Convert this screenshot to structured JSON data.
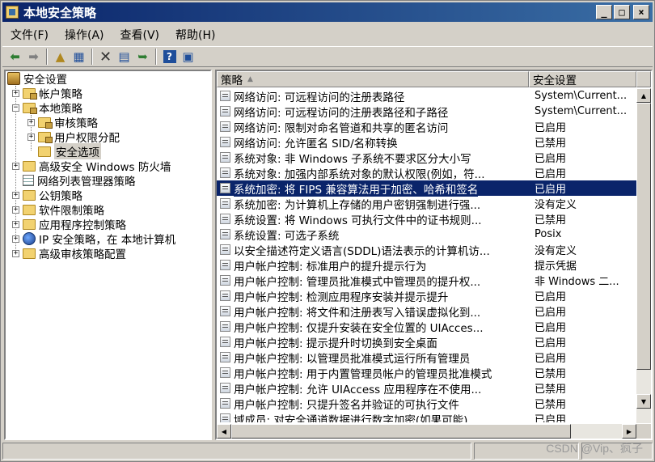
{
  "window": {
    "title": "本地安全策略",
    "min_label": "_",
    "max_label": "□",
    "close_label": "×"
  },
  "menu": [
    "文件(F)",
    "操作(A)",
    "查看(V)",
    "帮助(H)"
  ],
  "toolbar": {
    "icons": [
      "back-arrow-icon",
      "forward-arrow-icon",
      "up-folder-icon",
      "show-tree-icon",
      "delete-icon",
      "properties-icon",
      "export-icon",
      "help-icon",
      "console-icon"
    ]
  },
  "tree": [
    {
      "label": "安全设置",
      "level": 0,
      "expander": "",
      "icon": "shield"
    },
    {
      "label": "帐户策略",
      "level": 1,
      "expander": "+",
      "icon": "folder-locked"
    },
    {
      "label": "本地策略",
      "level": 1,
      "expander": "−",
      "icon": "folder-locked"
    },
    {
      "label": "审核策略",
      "level": 2,
      "expander": "+",
      "icon": "folder-locked"
    },
    {
      "label": "用户权限分配",
      "level": 2,
      "expander": "+",
      "icon": "folder-locked"
    },
    {
      "label": "安全选项",
      "level": 2,
      "expander": "",
      "icon": "folder",
      "selected": true
    },
    {
      "label": "高级安全 Windows 防火墙",
      "level": 1,
      "expander": "+",
      "icon": "folder"
    },
    {
      "label": "网络列表管理器策略",
      "level": 1,
      "expander": "",
      "icon": "netlist"
    },
    {
      "label": "公钥策略",
      "level": 1,
      "expander": "+",
      "icon": "folder"
    },
    {
      "label": "软件限制策略",
      "level": 1,
      "expander": "+",
      "icon": "folder"
    },
    {
      "label": "应用程序控制策略",
      "level": 1,
      "expander": "+",
      "icon": "folder"
    },
    {
      "label": "IP 安全策略，在 本地计算机",
      "level": 1,
      "expander": "+",
      "icon": "ip"
    },
    {
      "label": "高级审核策略配置",
      "level": 1,
      "expander": "+",
      "icon": "folder"
    }
  ],
  "list": {
    "headers": {
      "policy": "策略",
      "setting": "安全设置"
    },
    "rows": [
      {
        "policy": "网络访问: 可远程访问的注册表路径",
        "setting": "System\\Current..."
      },
      {
        "policy": "网络访问: 可远程访问的注册表路径和子路径",
        "setting": "System\\Current..."
      },
      {
        "policy": "网络访问: 限制对命名管道和共享的匿名访问",
        "setting": "已启用"
      },
      {
        "policy": "网络访问: 允许匿名 SID/名称转换",
        "setting": "已禁用"
      },
      {
        "policy": "系统对象: 非 Windows 子系统不要求区分大小写",
        "setting": "已启用"
      },
      {
        "policy": "系统对象: 加强内部系统对象的默认权限(例如，符...",
        "setting": "已启用"
      },
      {
        "policy": "系统加密: 将 FIPS 兼容算法用于加密、哈希和签名",
        "setting": "已启用",
        "selected": true
      },
      {
        "policy": "系统加密: 为计算机上存储的用户密钥强制进行强...",
        "setting": "没有定义"
      },
      {
        "policy": "系统设置: 将 Windows 可执行文件中的证书规则...",
        "setting": "已禁用"
      },
      {
        "policy": "系统设置: 可选子系统",
        "setting": "Posix"
      },
      {
        "policy": "以安全描述符定义语言(SDDL)语法表示的计算机访...",
        "setting": "没有定义"
      },
      {
        "policy": "用户帐户控制: 标准用户的提升提示行为",
        "setting": "提示凭据"
      },
      {
        "policy": "用户帐户控制: 管理员批准模式中管理员的提升权...",
        "setting": "非 Windows 二..."
      },
      {
        "policy": "用户帐户控制: 检测应用程序安装并提示提升",
        "setting": "已启用"
      },
      {
        "policy": "用户帐户控制: 将文件和注册表写入错误虚拟化到...",
        "setting": "已启用"
      },
      {
        "policy": "用户帐户控制: 仅提升安装在安全位置的 UIAcces...",
        "setting": "已启用"
      },
      {
        "policy": "用户帐户控制: 提示提升时切换到安全桌面",
        "setting": "已启用"
      },
      {
        "policy": "用户帐户控制: 以管理员批准模式运行所有管理员",
        "setting": "已启用"
      },
      {
        "policy": "用户帐户控制: 用于内置管理员帐户的管理员批准模式",
        "setting": "已禁用"
      },
      {
        "policy": "用户帐户控制: 允许 UIAccess 应用程序在不使用...",
        "setting": "已禁用"
      },
      {
        "policy": "用户帐户控制: 只提升签名并验证的可执行文件",
        "setting": "已禁用"
      },
      {
        "policy": "域成员: 对安全通道数据进行数字加密(如果可能)",
        "setting": "已启用"
      }
    ]
  },
  "watermark": "CSDN @Vip、疯子"
}
